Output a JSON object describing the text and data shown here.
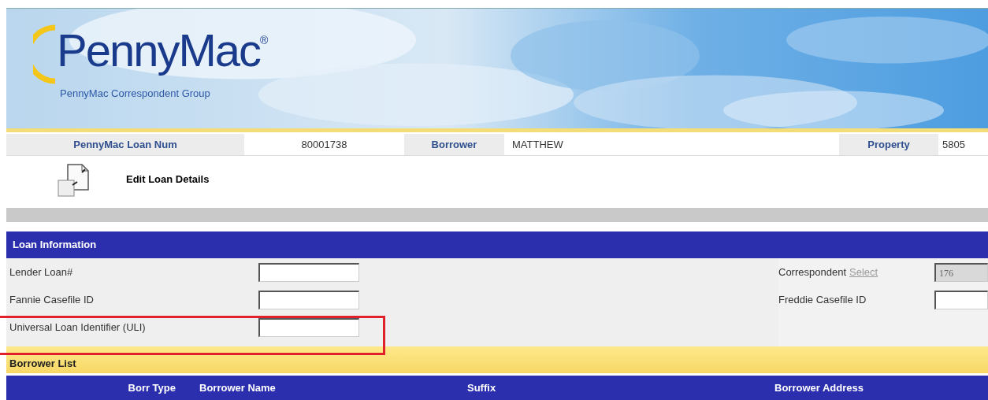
{
  "header": {
    "logo": {
      "name": "PennyMac",
      "mark": "®",
      "tagline": "PennyMac Correspondent Group"
    }
  },
  "summary": [
    {
      "label": "PennyMac Loan Num",
      "value": "80001738"
    },
    {
      "label": "Borrower",
      "value": "MATTHEW"
    },
    {
      "label": "Property",
      "value": "5805"
    }
  ],
  "action": {
    "label": "Edit Loan Details"
  },
  "loan_information": {
    "title": "Loan Information",
    "left_fields": [
      {
        "label": "Lender Loan#"
      },
      {
        "label": "Fannie Casefile ID"
      },
      {
        "label": "Universal Loan Identifier (ULI)"
      }
    ],
    "right_fields": [
      {
        "label": "Correspondent",
        "link": "Select",
        "value": "176",
        "disabled": true
      },
      {
        "label": "Freddie Casefile ID",
        "disabled": false
      }
    ]
  },
  "borrower_list": {
    "title": "Borrower List",
    "columns": [
      "Borr Type",
      "Borrower Name",
      "Suffix",
      "Borrower Address"
    ]
  },
  "annotation": {
    "kind": "highlight"
  }
}
